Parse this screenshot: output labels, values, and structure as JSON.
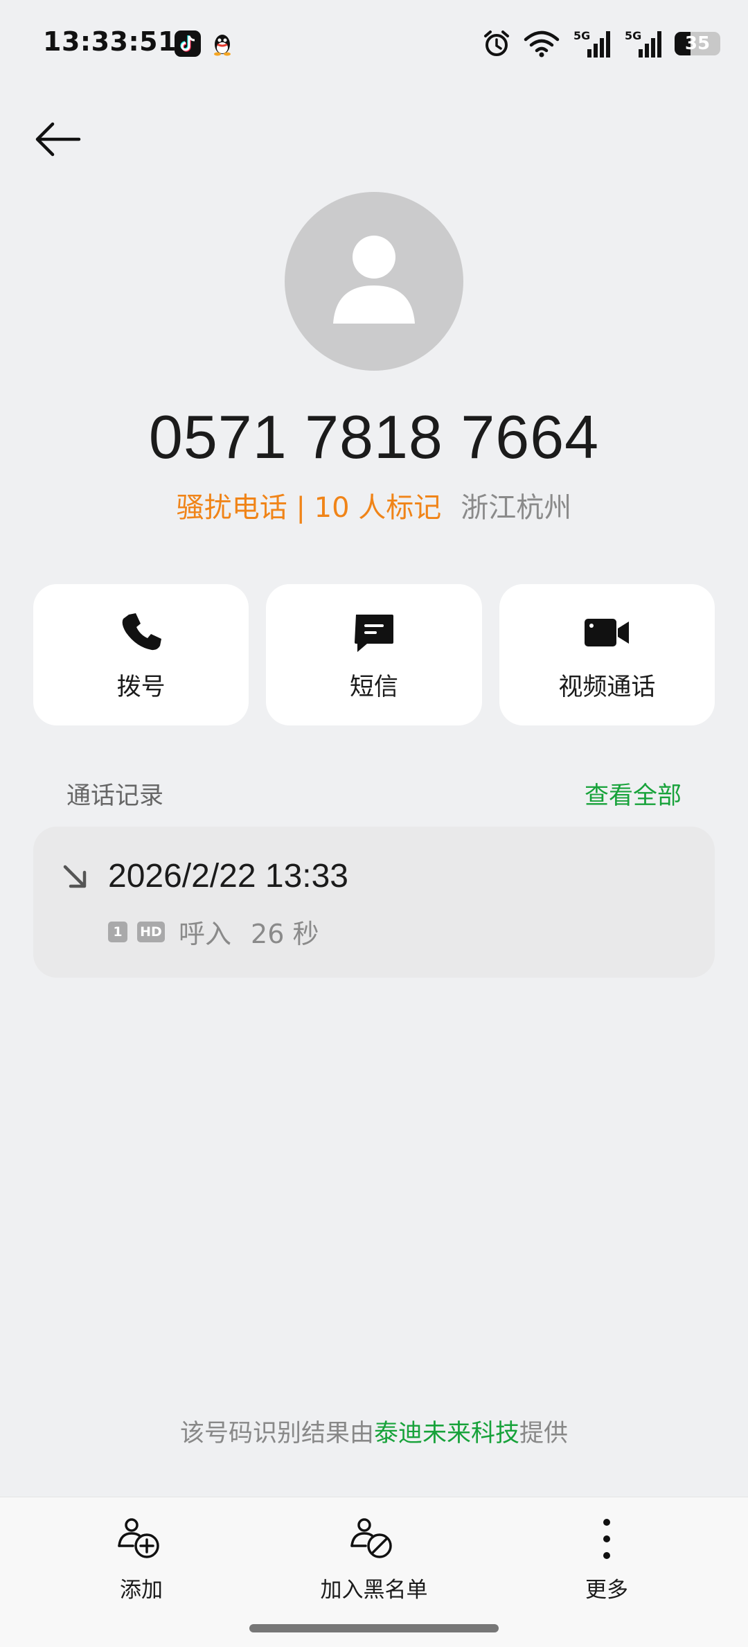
{
  "status_bar": {
    "time": "13:33:51",
    "apps": [
      "tiktok-icon",
      "qq-icon"
    ],
    "icons": [
      "alarm-icon",
      "wifi-icon",
      "signal-5g-icon",
      "signal-5g-icon"
    ],
    "network1": "5G",
    "network2": "5G",
    "battery": "35",
    "battery_level": 0.35
  },
  "contact": {
    "number": "0571 7818 7664",
    "spam_tag": "骚扰电话 | 10 人标记",
    "location": "浙江杭州"
  },
  "actions": [
    {
      "label": "拨号",
      "icon": "phone-icon"
    },
    {
      "label": "短信",
      "icon": "message-icon"
    },
    {
      "label": "视频通话",
      "icon": "video-call-icon"
    }
  ],
  "records": {
    "title": "通话记录",
    "view_all": "查看全部",
    "items": [
      {
        "datetime": "2026/2/22 13:33",
        "sim": "1",
        "hd": "HD",
        "type": "呼入",
        "duration": "26 秒"
      }
    ]
  },
  "provider": {
    "prefix": "该号码识别结果由",
    "brand": "泰迪未来科技",
    "suffix": "提供"
  },
  "bottom_bar": [
    {
      "label": "添加",
      "icon": "add-contact-icon"
    },
    {
      "label": "加入黑名单",
      "icon": "block-contact-icon"
    },
    {
      "label": "更多",
      "icon": "more-icon"
    }
  ],
  "colors": {
    "background": "#eff0f2",
    "spam": "#f08418",
    "accent_green": "#17a23a",
    "card": "#ffffff"
  }
}
